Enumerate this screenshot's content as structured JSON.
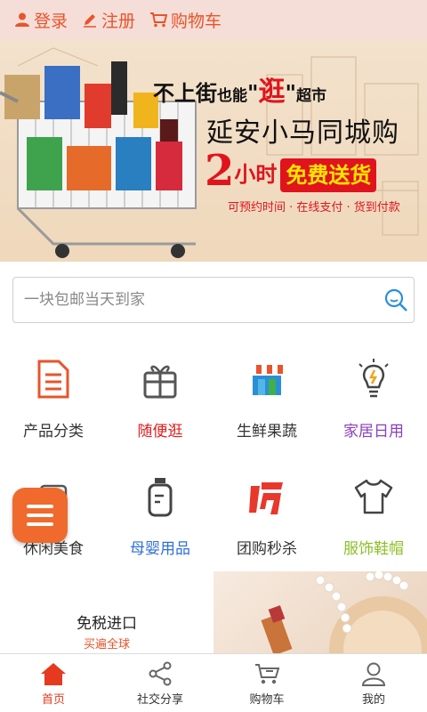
{
  "topbar": {
    "login": "登录",
    "register": "注册",
    "cart": "购物车"
  },
  "banner": {
    "line1_a": "不上街",
    "line1_b": "也能",
    "line1_c": "逛",
    "line1_d": "超市",
    "line2": "延安小马同城购",
    "line3_num": "2",
    "line3_hours": "小时",
    "line3_free": "免费送货",
    "line4": "可预约时间 · 在线支付 · 货到付款",
    "slides_total": 3,
    "active_slide": 3
  },
  "search": {
    "placeholder": "一块包邮当天到家"
  },
  "categories": [
    {
      "label": "产品分类",
      "color": "#333333",
      "icon": "document-icon"
    },
    {
      "label": "随便逛",
      "color": "#e02020",
      "icon": "gift-icon"
    },
    {
      "label": "生鲜果蔬",
      "color": "#333333",
      "icon": "market-stall-icon"
    },
    {
      "label": "家居日用",
      "color": "#8a3fc0",
      "icon": "lightbulb-icon"
    },
    {
      "label": "休闲美食",
      "color": "#333333",
      "icon": "snack-icon"
    },
    {
      "label": "母婴用品",
      "color": "#2f6fd6",
      "icon": "baby-bottle-icon"
    },
    {
      "label": "团购秒杀",
      "color": "#333333",
      "icon": "grab-icon"
    },
    {
      "label": "服饰鞋帽",
      "color": "#8cbf26",
      "icon": "tshirt-icon"
    }
  ],
  "promo": {
    "title": "免税进口",
    "subtitle": "买遍全球"
  },
  "bottomnav": [
    {
      "label": "首页",
      "icon": "home-icon",
      "active": true
    },
    {
      "label": "社交分享",
      "icon": "share-icon",
      "active": false
    },
    {
      "label": "购物车",
      "icon": "cart-icon",
      "active": false
    },
    {
      "label": "我的",
      "icon": "user-icon",
      "active": false
    }
  ],
  "colors": {
    "accent": "#e8542b",
    "topbar_bg": "#f6ded8",
    "fab": "#ef6a2c"
  }
}
